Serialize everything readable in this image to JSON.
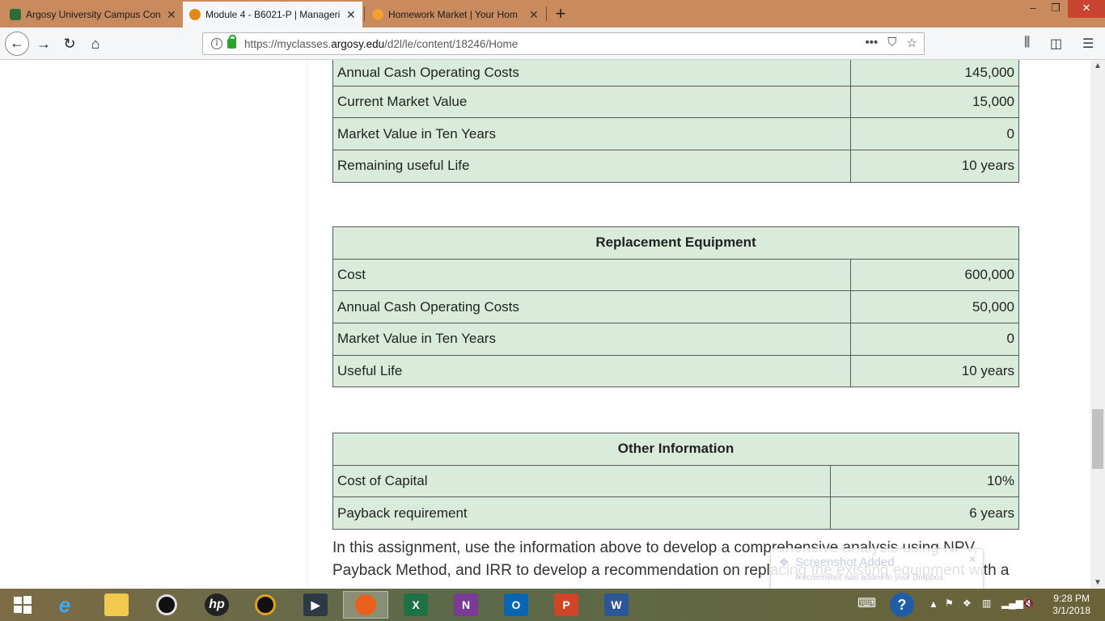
{
  "tabs": [
    {
      "title": "Argosy University Campus Con",
      "favicon_color": "#2e6b3a"
    },
    {
      "title": "Module 4 - B6021-P | Manageri",
      "favicon_color": "#e08a18"
    },
    {
      "title": "Homework Market | Your Hom",
      "favicon_color": "#f0a030"
    }
  ],
  "window": {
    "minimize": "–",
    "restore": "❐",
    "close": "✕"
  },
  "nav": {
    "url_prefix": "https://myclasses.",
    "url_domain": "argosy.edu",
    "url_path": "/d2l/le/content/18246/Home",
    "more": "•••"
  },
  "existing_table": {
    "rows": [
      {
        "label": "Annual Cash Operating Costs",
        "value": "145,000"
      },
      {
        "label": "Current Market Value",
        "value": "15,000"
      },
      {
        "label": "Market Value in Ten Years",
        "value": "0"
      },
      {
        "label": "Remaining useful Life",
        "value": "10 years"
      }
    ]
  },
  "replacement_table": {
    "title": "Replacement Equipment",
    "rows": [
      {
        "label": "Cost",
        "value": "600,000"
      },
      {
        "label": "Annual Cash Operating Costs",
        "value": "50,000"
      },
      {
        "label": "Market Value in Ten Years",
        "value": "0"
      },
      {
        "label": "Useful Life",
        "value": "10 years"
      }
    ]
  },
  "other_table": {
    "title": "Other Information",
    "rows": [
      {
        "label": "Cost of Capital",
        "value": "10%"
      },
      {
        "label": "Payback requirement",
        "value": "6 years"
      }
    ]
  },
  "paragraph": {
    "line1": "In this assignment, use the information above to develop a comprehensive analysis using NPV,",
    "line2": "Payback Method, and IRR to develop a recommendation on replacing the existing equipment with a"
  },
  "toast": {
    "title": "Screenshot Added",
    "body": "A screenshot was added to your Dropbox."
  },
  "taskbar": {
    "time": "9:28 PM",
    "date": "3/1/2018"
  },
  "colors": {
    "table_fill": "#d9ecdc",
    "tabstrip": "#c98b5e"
  }
}
